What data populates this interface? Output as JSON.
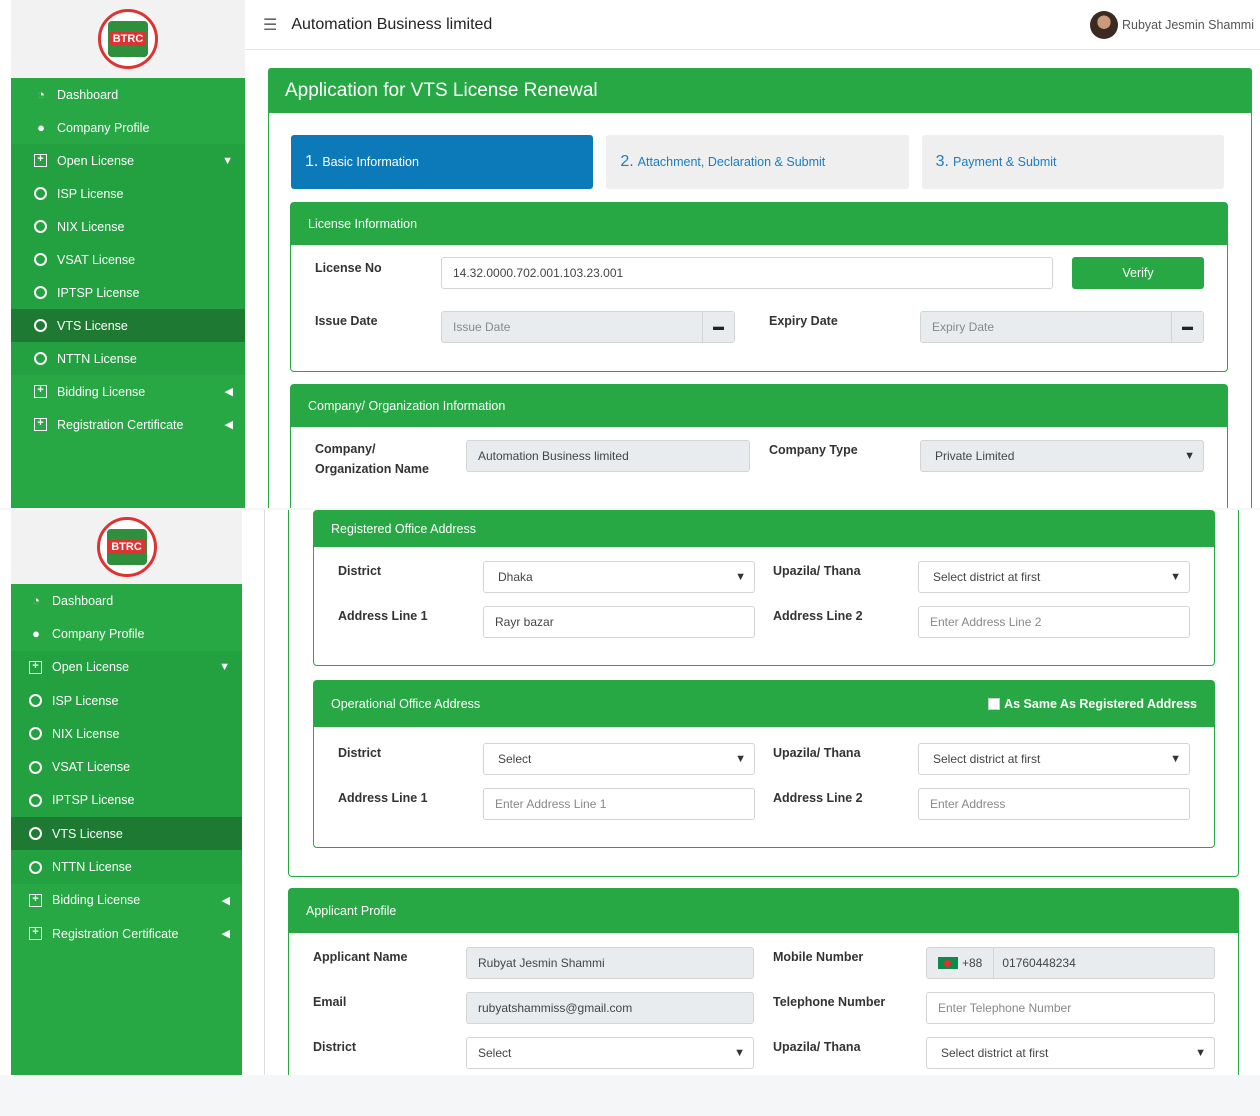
{
  "app": {
    "brand": "Automation Business limited",
    "user_name": "Rubyat Jesmin Shammi",
    "logo_text": "BTRC"
  },
  "sidebar": {
    "items": [
      {
        "label": "Dashboard",
        "icon": "dashboard-icon"
      },
      {
        "label": "Company Profile",
        "icon": "user-icon"
      },
      {
        "label": "Open License",
        "icon": "plus-square-icon"
      },
      {
        "label": "ISP License",
        "icon": "circle-icon"
      },
      {
        "label": "NIX License",
        "icon": "circle-icon"
      },
      {
        "label": "VSAT License",
        "icon": "circle-icon"
      },
      {
        "label": "IPTSP License",
        "icon": "circle-icon"
      },
      {
        "label": "VTS License",
        "icon": "circle-icon"
      },
      {
        "label": "NTTN License",
        "icon": "circle-icon"
      },
      {
        "label": "Bidding License",
        "icon": "plus-square-icon"
      },
      {
        "label": "Registration Certificate",
        "icon": "plus-square-icon"
      }
    ]
  },
  "page": {
    "title": "Application for VTS License Renewal",
    "steps": [
      {
        "num": "1.",
        "label": "Basic Information"
      },
      {
        "num": "2.",
        "label": "Attachment, Declaration & Submit"
      },
      {
        "num": "3.",
        "label": "Payment & Submit"
      }
    ]
  },
  "license_info": {
    "heading": "License Information",
    "license_no_label": "License No",
    "license_no": "14.32.0000.702.001.103.23.001",
    "verify_label": "Verify",
    "issue_date_label": "Issue Date",
    "issue_date_placeholder": "Issue Date",
    "expiry_date_label": "Expiry Date",
    "expiry_date_placeholder": "Expiry Date"
  },
  "company_info": {
    "heading": "Company/ Organization Information",
    "name_label_1": "Company/",
    "name_label_2": "Organization Name",
    "name_value": "Automation Business limited",
    "type_label": "Company Type",
    "type_value": "Private Limited"
  },
  "registered_address": {
    "heading": "Registered Office Address",
    "district_label": "District",
    "district_value": "Dhaka",
    "upazila_label": "Upazila/ Thana",
    "upazila_value": "Select district at first",
    "addr1_label": "Address Line 1",
    "addr1_value": "Rayr bazar",
    "addr2_label": "Address Line 2",
    "addr2_placeholder": "Enter  Address Line 2"
  },
  "operational_address": {
    "heading": "Operational Office Address",
    "same_as_label": "As Same As Registered Address",
    "district_label": "District",
    "district_value": "Select",
    "upazila_label": "Upazila/ Thana",
    "upazila_value": "Select district at first",
    "addr1_label": "Address Line 1",
    "addr1_placeholder": "Enter  Address Line 1",
    "addr2_label": "Address Line 2",
    "addr2_placeholder": "Enter  Address"
  },
  "applicant": {
    "heading": "Applicant Profile",
    "name_label": "Applicant Name",
    "name_value": "Rubyat Jesmin Shammi",
    "mobile_label": "Mobile Number",
    "mobile_code": "+88",
    "mobile_value": "01760448234",
    "email_label": "Email",
    "email_value": "rubyatshammiss@gmail.com",
    "telephone_label": "Telephone Number",
    "telephone_placeholder": "Enter Telephone Number",
    "district_label": "District",
    "district_value": "Select",
    "upazila_label": "Upazila/ Thana",
    "upazila_value": "Select district at first"
  },
  "colors": {
    "green": "#27a844",
    "green_dark": "#1e7a33",
    "blue": "#0c7ab8"
  }
}
